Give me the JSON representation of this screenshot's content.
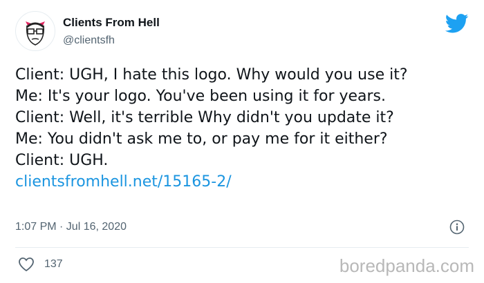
{
  "author": {
    "name": "Clients From Hell",
    "handle": "@clientsfh",
    "avatar_icon": "cartoon-devil-face-icon"
  },
  "tweet": {
    "lines": [
      "Client: UGH, I hate this logo. Why would you use it?",
      "Me: It's your logo. You've been using it for years.",
      "Client: Well, it's terrible Why didn't you update it?",
      "Me: You didn't ask me to, or pay me for it either?",
      "Client: UGH."
    ],
    "link": "clientsfromhell.net/15165-2/"
  },
  "meta": {
    "timestamp": "1:07 PM · Jul 16, 2020"
  },
  "actions": {
    "likes": "137"
  },
  "watermark": "boredpanda.com",
  "colors": {
    "link": "#1b95e0",
    "twitter_blue": "#1da1f2",
    "secondary_text": "#536471"
  }
}
